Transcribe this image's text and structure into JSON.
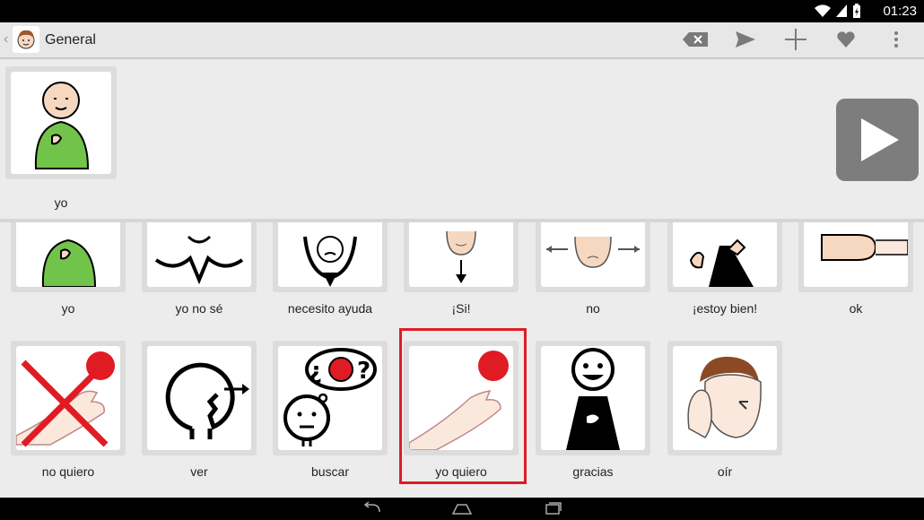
{
  "status": {
    "time": "01:23",
    "icons": [
      "wifi-icon",
      "signal-icon",
      "battery-charging-icon"
    ]
  },
  "appbar": {
    "title": "General",
    "actions": [
      "backspace-icon",
      "send-icon",
      "add-icon",
      "heart-icon",
      "more-vert-icon"
    ]
  },
  "sentence": {
    "items": [
      {
        "label": "yo"
      }
    ]
  },
  "grid": {
    "row1": [
      {
        "label": "yo"
      },
      {
        "label": "yo no sé"
      },
      {
        "label": "necesito ayuda"
      },
      {
        "label": "¡Si!"
      },
      {
        "label": "no"
      },
      {
        "label": "¡estoy bien!"
      },
      {
        "label": "ok"
      }
    ],
    "row2": [
      {
        "label": "no quiero"
      },
      {
        "label": "ver"
      },
      {
        "label": "buscar"
      },
      {
        "label": "yo quiero"
      },
      {
        "label": "gracias"
      },
      {
        "label": "oír"
      }
    ],
    "selected_label": "yo quiero"
  },
  "colors": {
    "accent_red": "#e01b24",
    "play_bg": "#7d7d7d"
  }
}
